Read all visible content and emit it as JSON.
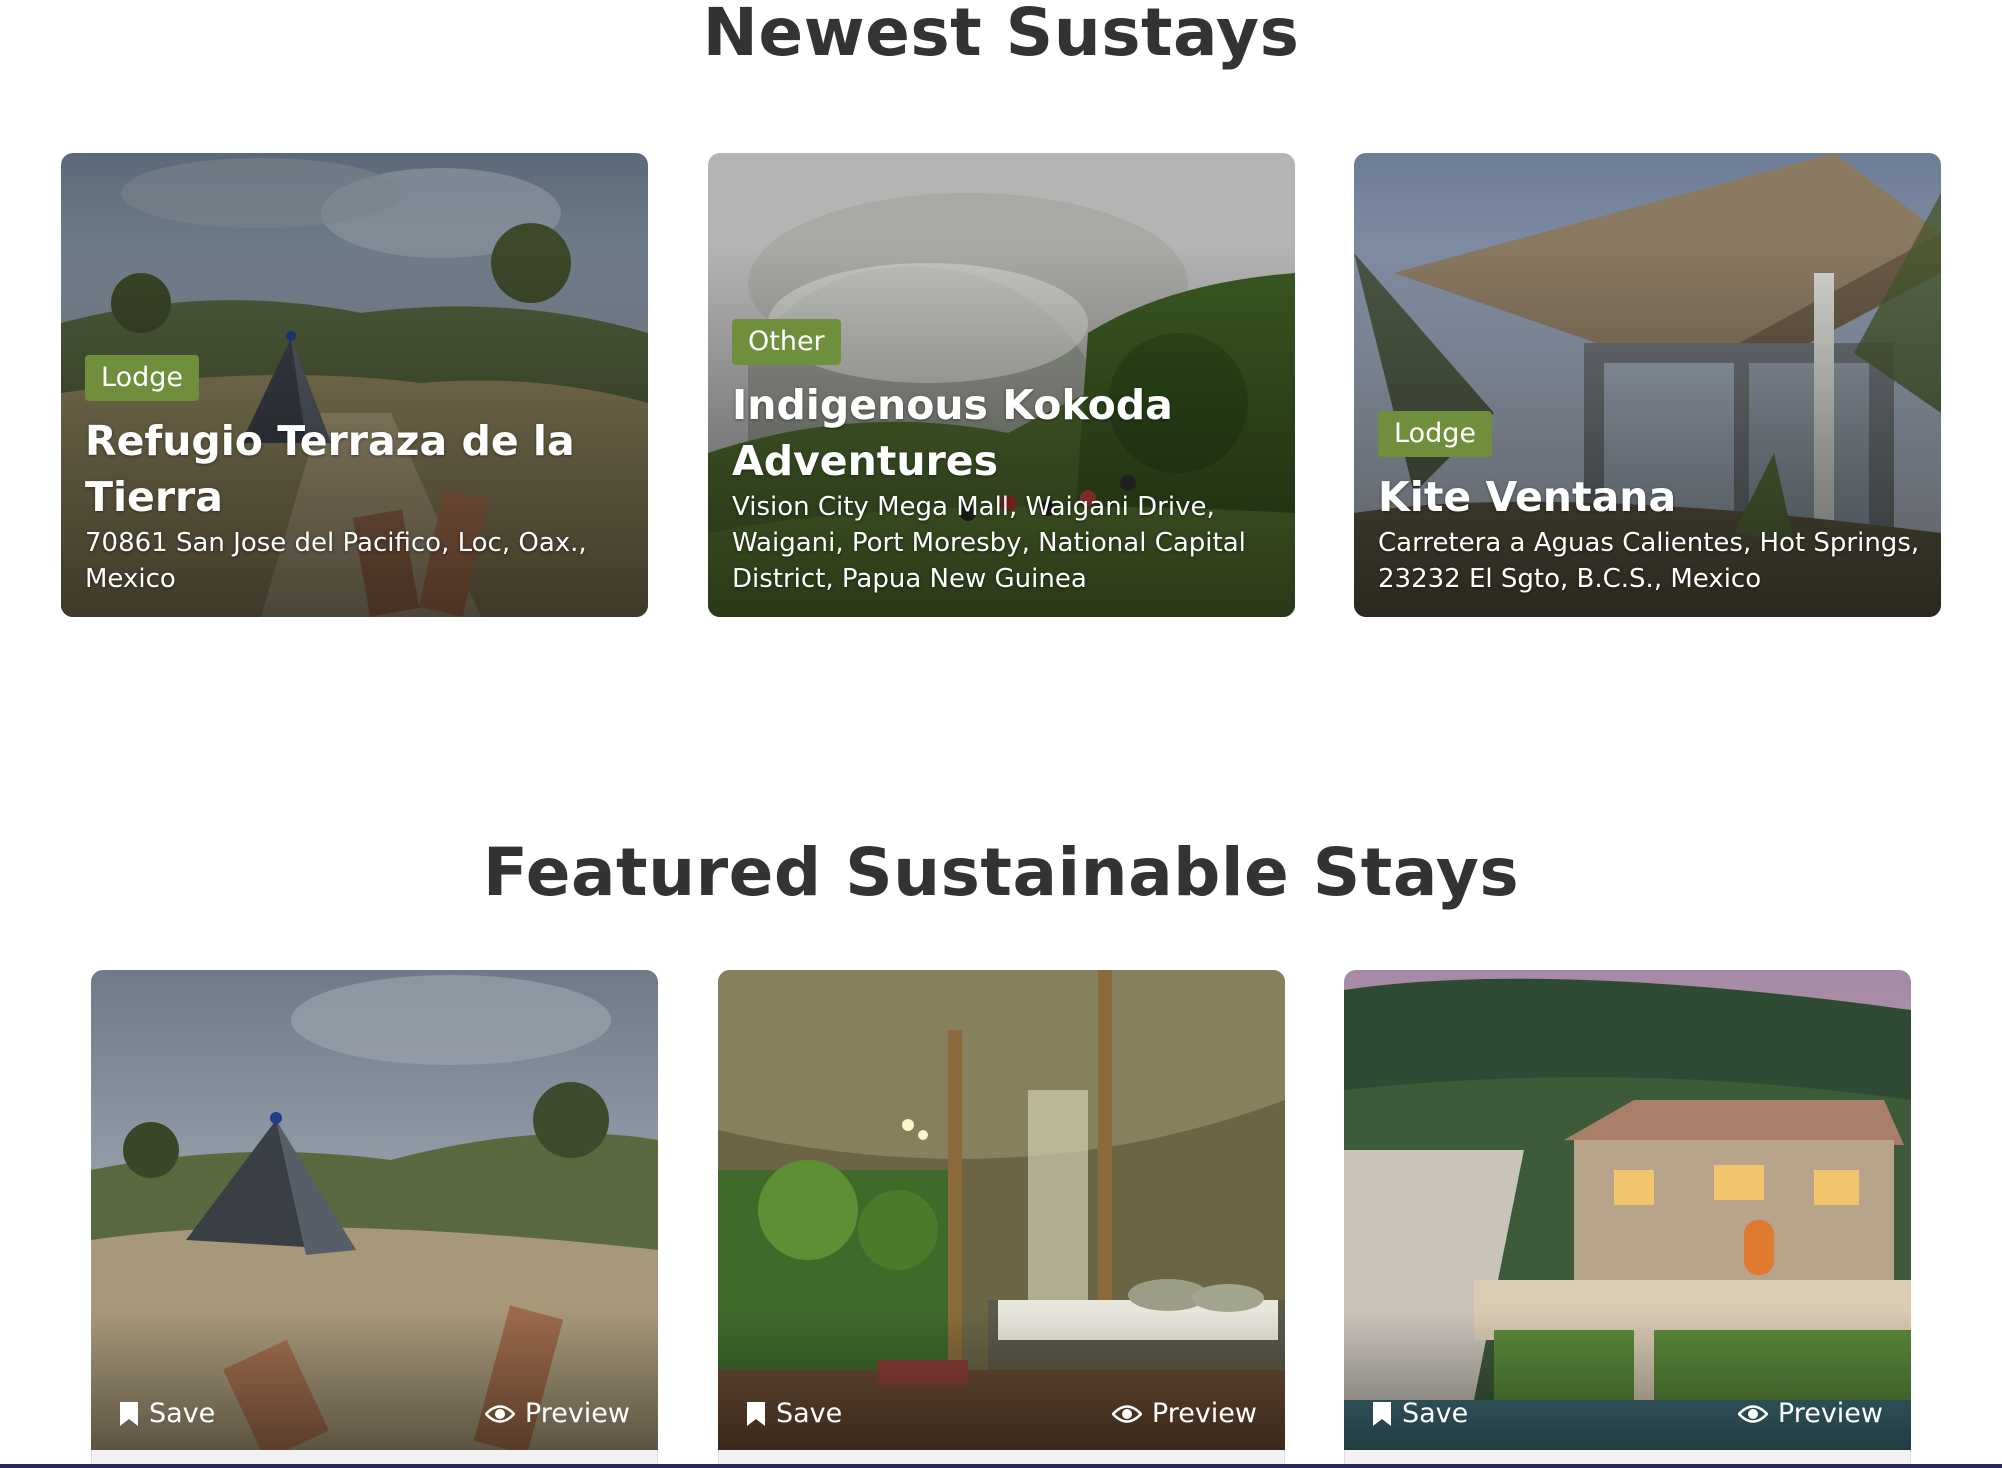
{
  "newest": {
    "title": "Newest Sustays",
    "cards": [
      {
        "type": "Lodge",
        "name": "Refugio Terraza de la Tierra",
        "address": "70861 San Jose del Pacifico, Loc, Oax., Mexico"
      },
      {
        "type": "Other",
        "name": "Indigenous Kokoda Adventures",
        "address": "Vision City Mega Mall, Waigani Drive, Waigani, Port Moresby, National Capital District, Papua New Guinea"
      },
      {
        "type": "Lodge",
        "name": "Kite Ventana",
        "address": "Carretera a Aguas Calientes, Hot Springs, 23232 El Sgto, B.C.S., Mexico"
      }
    ]
  },
  "featured": {
    "title": "Featured Sustainable Stays",
    "cards": [
      {
        "save_label": "Save",
        "preview_label": "Preview"
      },
      {
        "save_label": "Save",
        "preview_label": "Preview"
      },
      {
        "save_label": "Save",
        "preview_label": "Preview"
      }
    ]
  },
  "colors": {
    "badge": "#6f8f3c",
    "heading": "#333333"
  },
  "icons": {
    "save": "bookmark-icon",
    "preview": "eye-icon"
  }
}
